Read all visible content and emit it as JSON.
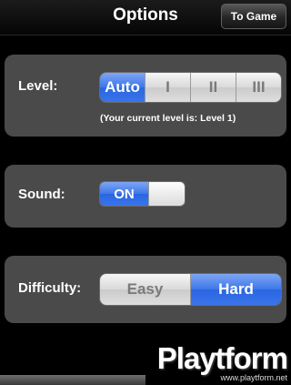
{
  "header": {
    "title": "Options",
    "to_game_label": "To Game"
  },
  "level": {
    "label": "Level:",
    "options": [
      "Auto",
      "I",
      "II",
      "III"
    ],
    "selected": "Auto",
    "note": "(Your current level is: Level 1)"
  },
  "sound": {
    "label": "Sound:",
    "state": "ON"
  },
  "difficulty": {
    "label": "Difficulty:",
    "options": [
      "Easy",
      "Hard"
    ],
    "selected": "Hard"
  },
  "watermark": {
    "logo": "Playtform",
    "url": "www.playtform.net"
  },
  "colors": {
    "accent": "#3d77ea",
    "panel": "#4a4a4a",
    "background": "#000000"
  }
}
